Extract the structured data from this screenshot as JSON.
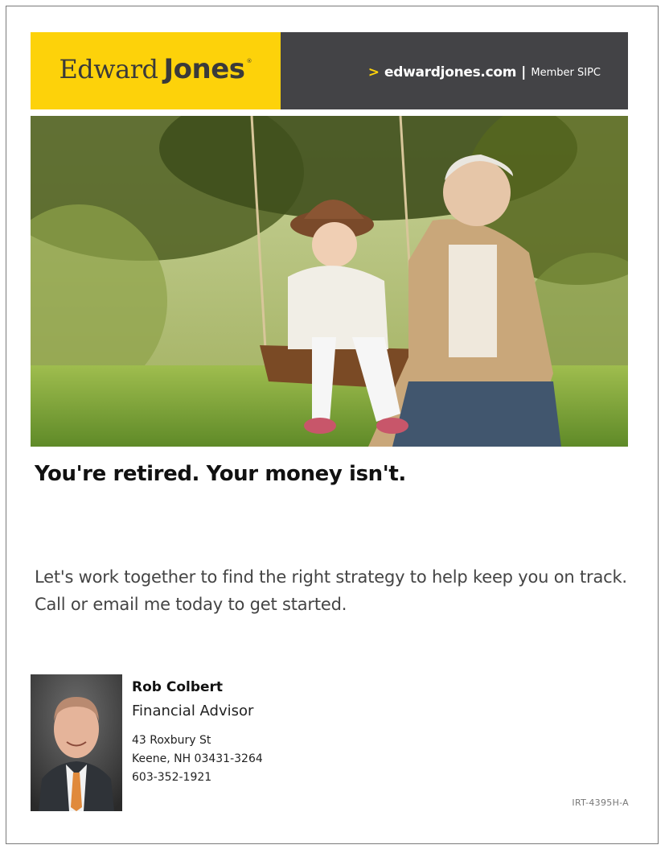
{
  "header": {
    "logo_word1": "Edward",
    "logo_word2": "Jones",
    "logo_reg": "®",
    "arrow": ">",
    "site_url": "edwardjones.com",
    "separator": "|",
    "member_text": "Member SIPC",
    "brand_yellow": "#fdd20a",
    "bar_gray": "#434346"
  },
  "hero": {
    "icon": "photo-grandfather-child-swing"
  },
  "headline": "You're retired. Your money isn't.",
  "body_text": "Let's work together to find the right strategy to help keep you on track. Call or email me today to get started.",
  "advisor": {
    "icon": "advisor-portrait",
    "name": "Rob Colbert",
    "title": "Financial Advisor",
    "address_line1": "43 Roxbury St",
    "address_line2": "Keene, NH 03431-3264",
    "phone": "603-352-1921"
  },
  "footer": {
    "doc_code": "IRT-4395H-A"
  }
}
